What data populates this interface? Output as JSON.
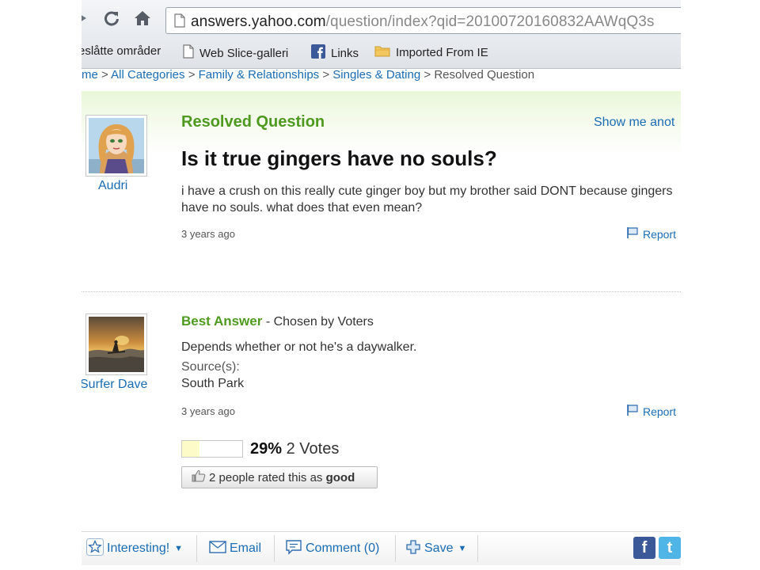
{
  "browser": {
    "url_host": "answers.yahoo.com",
    "url_path": "/question/index?qid=20100720160832AAWqQ3s",
    "bookmarks": [
      {
        "label": "eslåtte områder",
        "icon": "none"
      },
      {
        "label": "Web Slice-galleri",
        "icon": "page-icon"
      },
      {
        "label": "Links",
        "icon": "facebook-icon"
      },
      {
        "label": "Imported From IE",
        "icon": "folder-icon"
      }
    ]
  },
  "breadcrumb": {
    "items": [
      "me",
      "All Categories",
      "Family & Relationships",
      "Singles & Dating"
    ],
    "current": "Resolved Question",
    "separator": ">"
  },
  "question": {
    "heading": "Resolved Question",
    "show_me": "Show me anot",
    "asker": "Audri",
    "title": "Is it true gingers have no souls?",
    "body": "i have a crush on this really cute ginger boy but my brother said DONT because gingers have no souls. what does that even mean?",
    "time": "3 years ago",
    "report": "Report"
  },
  "answer": {
    "label": "Best Answer",
    "chosen": "- Chosen by Voters",
    "answerer": "Surfer Dave",
    "text": "Depends whether or not he's a daywalker.",
    "source_label": "Source(s):",
    "source_value": "South Park",
    "time": "3 years ago",
    "report": "Report",
    "vote_percent_text": "29%",
    "vote_fraction": 0.29,
    "votes_text": "2 Votes",
    "rated_prefix": "2 people rated this as",
    "rated_word": "good"
  },
  "toolbar": {
    "interesting": "Interesting!",
    "email": "Email",
    "comment": "Comment (0)",
    "save": "Save"
  },
  "colors": {
    "link_blue": "#1a6cb5",
    "heading_green": "#4e9a1f",
    "panel_green": "#eaf7da",
    "facebook_blue": "#3b5998",
    "twitter_blue": "#4fb4e6"
  }
}
